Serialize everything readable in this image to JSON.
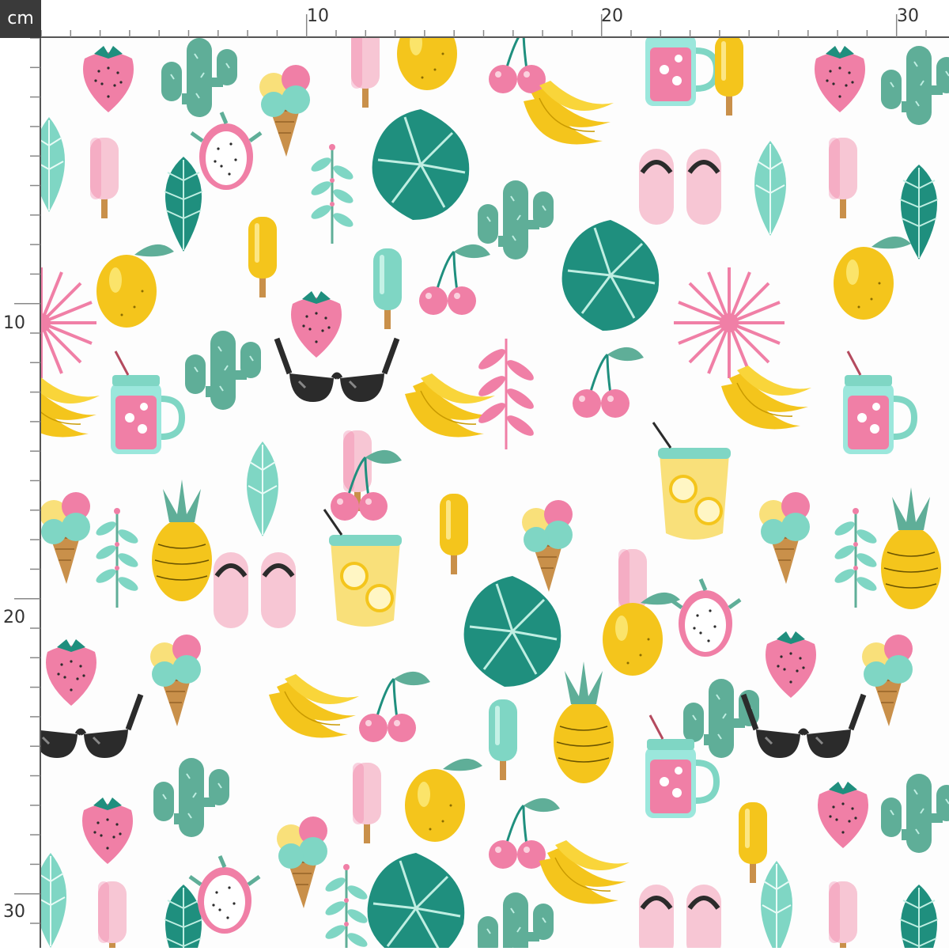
{
  "ruler": {
    "unit": "cm",
    "top_labels": [
      "10",
      "20",
      "30"
    ],
    "left_labels": [
      "10",
      "20",
      "30"
    ]
  },
  "fabric": {
    "background": "#fdfdfd",
    "motifs": [
      "strawberry-icon",
      "cactus-icon",
      "ice-cream-cone-icon",
      "popsicle-icon",
      "lemon-icon",
      "cherry-icon",
      "banana-icon",
      "flip-flops-icon",
      "tropical-leaf-icon",
      "mason-jar-drink-icon",
      "sunglasses-icon",
      "palm-fan-icon",
      "dragon-fruit-icon",
      "pineapple-icon",
      "monstera-leaf-icon",
      "lemonade-glass-icon",
      "herb-sprig-icon"
    ],
    "colors": {
      "teal": "#1f8f7e",
      "mint": "#7fd6c4",
      "sage": "#5fae98",
      "pink": "#f07fa6",
      "light_pink": "#f7c6d4",
      "yellow": "#f4c51c",
      "pale_yellow": "#f9e07a",
      "cone": "#c9904a",
      "black": "#2b2b2b"
    }
  }
}
